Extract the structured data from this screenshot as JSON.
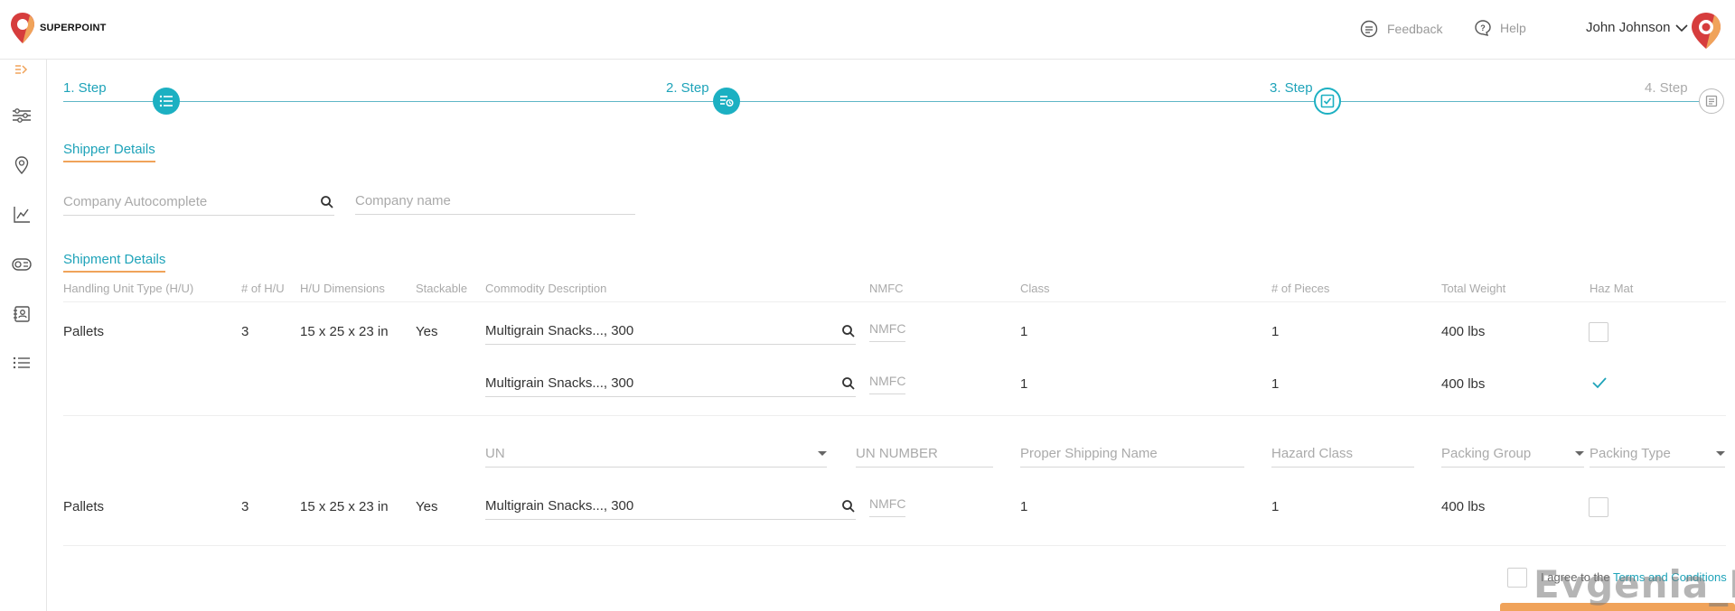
{
  "brand": {
    "name": "SUPERPOINT",
    "accent": "#1cb0c2",
    "orange": "#f0a35a"
  },
  "header": {
    "feedback": "Feedback",
    "help": "Help",
    "user_name": "John Johnson"
  },
  "sidebar": {
    "items": [
      "toggle-sidebar-icon",
      "sliders-icon",
      "location-icon",
      "analytics-icon",
      "ticket-icon",
      "contacts-icon",
      "list-icon"
    ]
  },
  "stepper": {
    "steps": [
      "1. Step",
      "2. Step",
      "3. Step",
      "4. Step"
    ]
  },
  "shipper": {
    "title": "Shipper Details",
    "company_autocomplete_placeholder": "Company Autocomplete",
    "company_name_placeholder": "Company name"
  },
  "shipment": {
    "title": "Shipment Details",
    "columns": [
      "Handling Unit Type (H/U)",
      "# of H/U",
      "H/U Dimensions",
      "Stackable",
      "Commodity Description",
      "NMFC",
      "Class",
      "# of Pieces",
      "Total Weight",
      "Haz Mat"
    ],
    "rows": [
      {
        "type": "Pallets",
        "count": "3",
        "dims": "15 x 25 x 23 in",
        "stackable": "Yes",
        "commodity": "Multigrain Snacks..., 300",
        "nmfc": "NMFC",
        "class": "1",
        "pieces": "1",
        "weight": "400 lbs"
      },
      {
        "commodity": "Multigrain Snacks..., 300",
        "nmfc": "NMFC",
        "class": "1",
        "pieces": "1",
        "weight": "400 lbs"
      },
      {
        "type": "Pallets",
        "count": "3",
        "dims": "15 x 25 x 23 in",
        "stackable": "Yes",
        "commodity": "Multigrain Snacks..., 300",
        "nmfc": "NMFC",
        "class": "1",
        "pieces": "1",
        "weight": "400 lbs"
      }
    ],
    "hazmat": {
      "un": "UN",
      "un_number": "UN NUMBER",
      "proper_shipping_name": "Proper Shipping Name",
      "hazard_class": "Hazard Class",
      "packing_group": "Packing Group",
      "packing_type": "Packing Type"
    }
  },
  "footer": {
    "agree_text": "I agree to the ",
    "terms_link": "Terms and Conditions"
  },
  "watermark": "Evgenia_L"
}
